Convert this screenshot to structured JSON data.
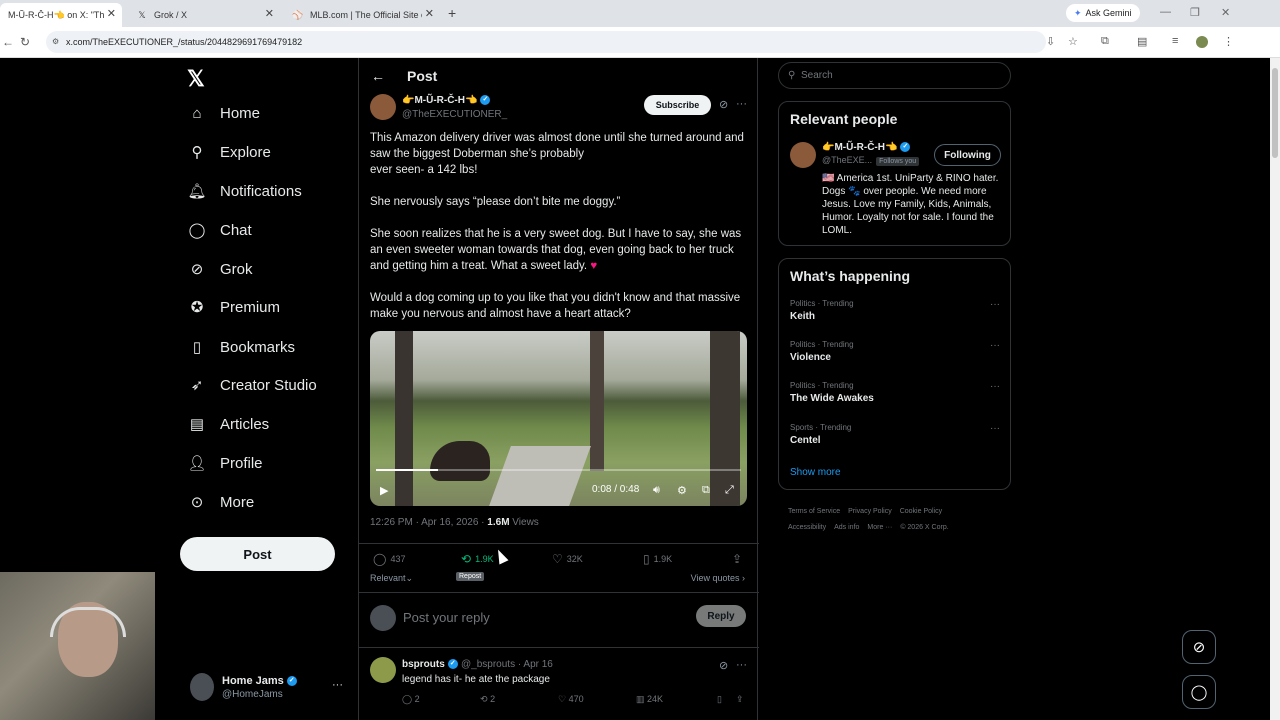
{
  "browser": {
    "tabs": [
      {
        "title": "M-Ũ-R-Č-H👈 on X: \"This A",
        "icon": "x-icon"
      },
      {
        "title": "Grok / X",
        "icon": "x-icon"
      },
      {
        "title": "MLB.com | The Official Site of M",
        "icon": "mlb-icon"
      }
    ],
    "gemini": "Ask Gemini",
    "url": "x.com/TheEXECUTIONER_/status/2044829691769479182"
  },
  "nav": {
    "items": [
      {
        "label": "Home",
        "icon": "home-icon"
      },
      {
        "label": "Explore",
        "icon": "search-icon"
      },
      {
        "label": "Notifications",
        "icon": "bell-icon"
      },
      {
        "label": "Chat",
        "icon": "chat-icon"
      },
      {
        "label": "Grok",
        "icon": "grok-icon"
      },
      {
        "label": "Premium",
        "icon": "premium-icon"
      },
      {
        "label": "Bookmarks",
        "icon": "bookmark-icon"
      },
      {
        "label": "Creator Studio",
        "icon": "rocket-icon"
      },
      {
        "label": "Articles",
        "icon": "article-icon"
      },
      {
        "label": "Profile",
        "icon": "person-icon"
      },
      {
        "label": "More",
        "icon": "more-icon"
      }
    ],
    "post_label": "Post"
  },
  "account": {
    "name": "Home Jams",
    "handle": "@HomeJams"
  },
  "header": {
    "title": "Post"
  },
  "post": {
    "author": "👉M-Ũ-R-Č-H👈",
    "handle": "@TheEXECUTIONER_",
    "subscribe": "Subscribe",
    "paragraphs": [
      "This Amazon delivery driver was almost done until she turned around and saw the biggest Doberman she’s probably\never seen- a 142 lbs!",
      "She nervously says “please don’t bite me doggy.”",
      "She soon realizes that he is a very sweet dog. But I have to say, she was an even sweeter woman towards that dog, even going back to her truck and getting him a treat. What a sweet lady.",
      "Would a dog coming up to you like that you didn't know and that massive make you nervous and almost have a heart attack?"
    ],
    "heart": "♥",
    "video": {
      "time": "0:08 / 0:48",
      "progress": 0.17
    },
    "time": "12:26 PM · Apr 16, 2026 · ",
    "views": "1.6M",
    "views_label": " Views",
    "stats": {
      "replies": "437",
      "reposts": "1.9K",
      "likes": "32K",
      "bookmarks": "1.9K"
    },
    "tooltip": "Repost",
    "sort": "Relevant",
    "view_quotes": "View quotes"
  },
  "reply_box": {
    "placeholder": "Post your reply",
    "button": "Reply"
  },
  "reply": {
    "name": "bsprouts",
    "handle": "@_bsprouts · Apr 16",
    "text": "legend has it- he ate the package",
    "stats": {
      "replies": "2",
      "reposts": "2",
      "likes": "470",
      "views": "24K"
    }
  },
  "search": {
    "placeholder": "Search"
  },
  "relevant_people": {
    "title": "Relevant people",
    "name": "👉M-Ũ-R-Č-H👈",
    "handle": "@TheEXE...",
    "follows_you": "Follows you",
    "follow_btn": "Following",
    "bio": "🇺🇸 America 1st. UniParty & RINO hater. Dogs 🐾 over people. We need more Jesus. Love my Family, Kids, Animals, Humor. Loyalty not for sale. I found the LOML."
  },
  "happening": {
    "title": "What’s happening",
    "trends": [
      {
        "category": "Politics · Trending",
        "title": "Keith"
      },
      {
        "category": "Politics · Trending",
        "title": "Violence"
      },
      {
        "category": "Politics · Trending",
        "title": "The Wide Awakes"
      },
      {
        "category": "Sports · Trending",
        "title": "Centel"
      }
    ],
    "show_more": "Show more"
  },
  "footer": {
    "links": [
      "Terms of Service",
      "Privacy Policy",
      "Cookie Policy",
      "Accessibility",
      "Ads info",
      "More ···",
      "© 2026 X Corp."
    ]
  },
  "colors": {
    "accent": "#1d9bf0",
    "repost_green": "#00ba7c",
    "like_pink": "#f91880"
  }
}
